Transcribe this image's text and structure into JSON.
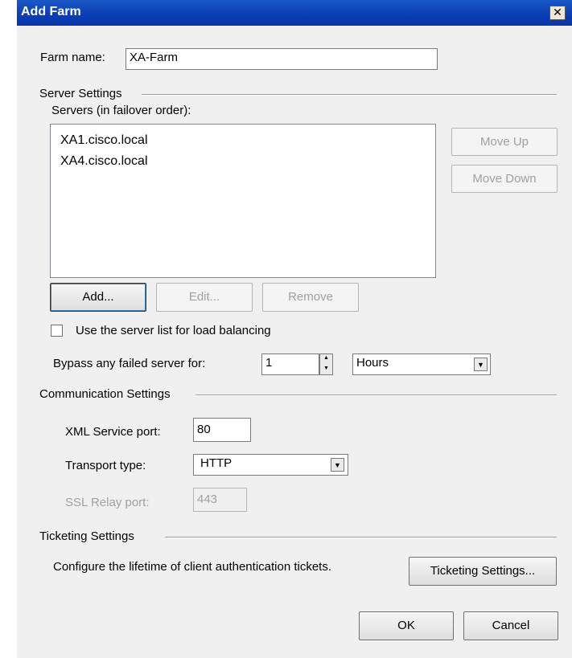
{
  "window": {
    "title": "Add Farm"
  },
  "farm": {
    "name_label": "Farm name:",
    "name_value": "XA-Farm"
  },
  "server_settings": {
    "group_label": "Server Settings",
    "servers_label": "Servers (in failover order):",
    "servers": [
      "XA1.cisco.local",
      "XA4.cisco.local"
    ],
    "move_up": "Move Up",
    "move_down": "Move Down",
    "add": "Add...",
    "edit": "Edit...",
    "remove": "Remove",
    "load_balancing_label": "Use the server list for load balancing",
    "load_balancing_checked": false,
    "bypass_label": "Bypass any failed server for:",
    "bypass_value": "1",
    "bypass_unit": "Hours"
  },
  "communication": {
    "group_label": "Communication Settings",
    "xml_port_label": "XML Service port:",
    "xml_port_value": "80",
    "transport_label": "Transport type:",
    "transport_value": "HTTP",
    "ssl_label": "SSL Relay port:",
    "ssl_value": "443"
  },
  "ticketing": {
    "group_label": "Ticketing Settings",
    "description": "Configure the lifetime of client authentication tickets.",
    "button": "Ticketing Settings..."
  },
  "footer": {
    "ok": "OK",
    "cancel": "Cancel"
  },
  "colors": {
    "titlebar": "#0a3db4",
    "dialog_bg": "#f0f0f0"
  },
  "icons": {
    "close": "close-icon",
    "dropdown": "chevron-down-icon",
    "spin_up": "arrow-up-icon",
    "spin_down": "arrow-down-icon"
  }
}
